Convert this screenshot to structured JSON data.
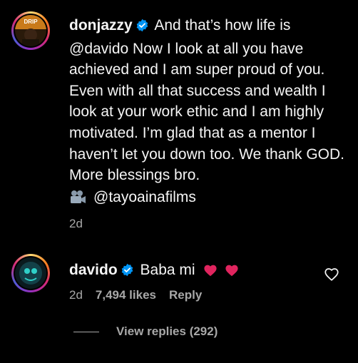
{
  "comment_1": {
    "avatar_badge": "DRIP",
    "username": "donjazzy",
    "text_line_1": "And that’s how life is",
    "mention": "@davido",
    "text_rest": "Now I look at all you have achieved and I am super proud of you. Even with all that success and wealth I look at your work ethic and I am highly motivated. I’m glad that as a mentor I haven’t let you down too. We thank GOD. More blessings bro.",
    "credit_icon": "movie-camera-icon",
    "credit_handle": "@tayoainafilms",
    "time": "2d"
  },
  "comment_2": {
    "username": "davido",
    "text": "Baba mi",
    "time": "2d",
    "likes": "7,494 likes",
    "reply_label": "Reply"
  },
  "view_replies": {
    "label": "View replies (292)"
  },
  "colors": {
    "background": "#000000",
    "text": "#f5f5f5",
    "muted": "#a8a8a8",
    "verified": "#0095f6",
    "heart": "#ff3040"
  }
}
